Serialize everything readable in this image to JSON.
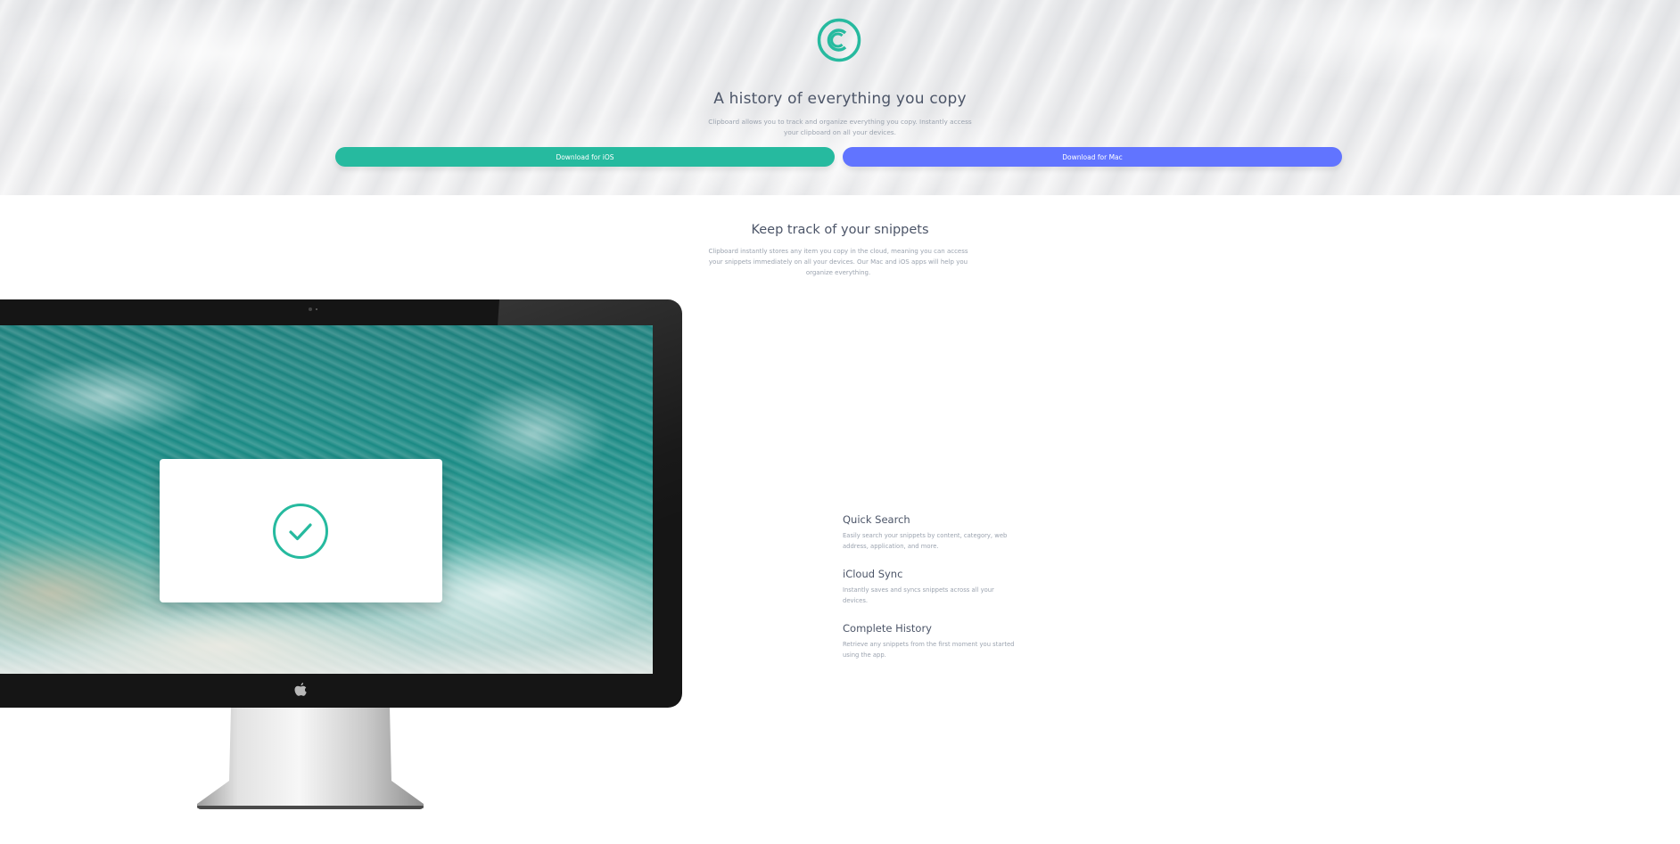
{
  "hero": {
    "title": "A history of everything you copy",
    "description": "Clipboard allows you to track and organize everything you copy. Instantly access your clipboard on all your devices.",
    "buttons": {
      "ios": "Download for iOS",
      "mac": "Download for Mac"
    }
  },
  "snippets": {
    "title": "Keep track of your snippets",
    "description": "Clipboard instantly stores any item you copy in the cloud, meaning you can access your snippets immediately on all your devices. Our Mac and iOS apps will help you organize everything."
  },
  "features": [
    {
      "title": "Quick Search",
      "description": "Easily search your snippets by content, category, web address, application, and more."
    },
    {
      "title": "iCloud Sync",
      "description": "Instantly saves and syncs snippets across all your devices."
    },
    {
      "title": "Complete History",
      "description": "Retrieve any snippets from the first moment you started using the app."
    }
  ],
  "colors": {
    "accent_green": "#26ba9f",
    "accent_blue": "#6174ff",
    "heading": "#4c5568",
    "body_text": "#9ba3af"
  },
  "icons": {
    "logo": "clipboard-logo-icon",
    "check": "check-circle-icon",
    "apple": "apple-icon"
  }
}
